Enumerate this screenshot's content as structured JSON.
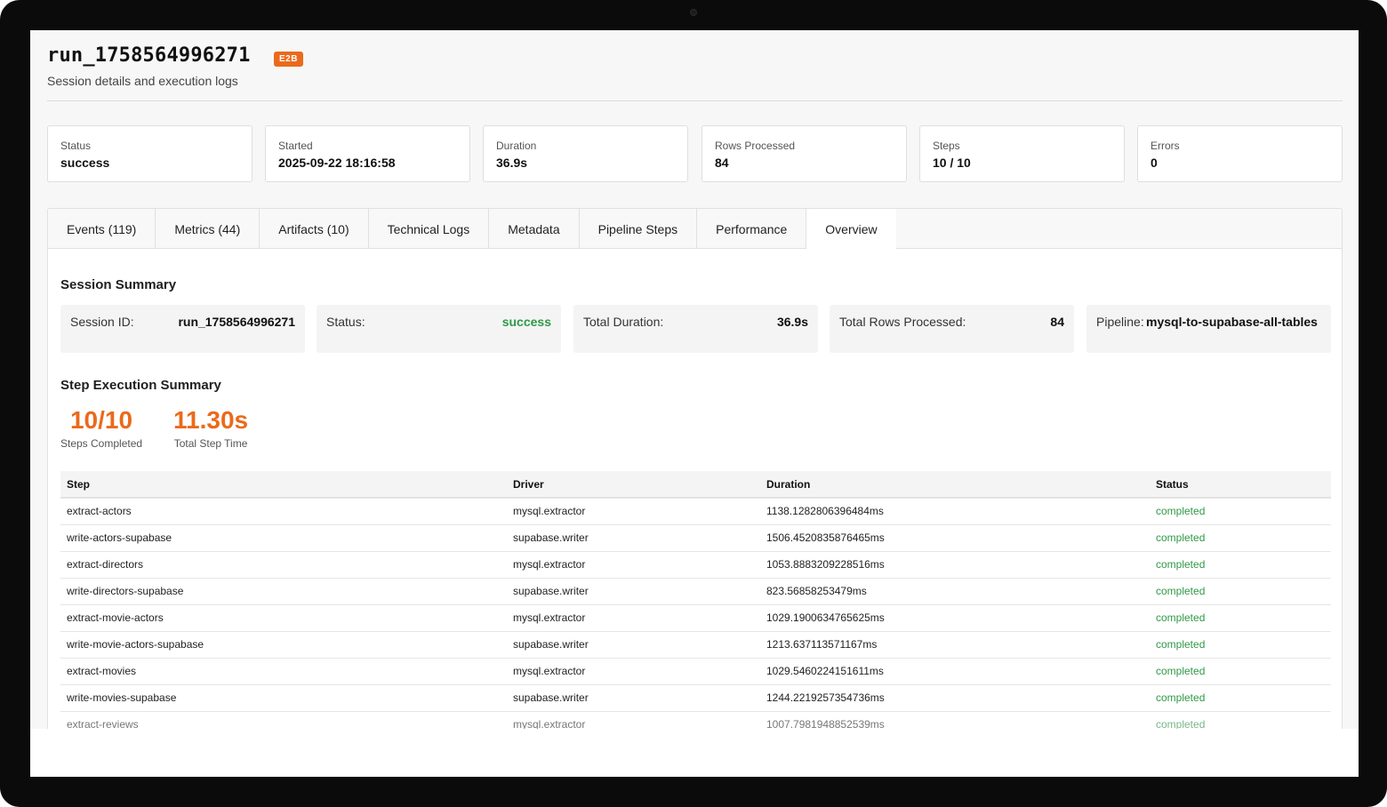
{
  "header": {
    "run_id": "run_1758564996271",
    "badge": "E2B",
    "subtitle": "Session details and execution logs"
  },
  "stats": [
    {
      "label": "Status",
      "value": "success"
    },
    {
      "label": "Started",
      "value": "2025-09-22 18:16:58"
    },
    {
      "label": "Duration",
      "value": "36.9s"
    },
    {
      "label": "Rows Processed",
      "value": "84"
    },
    {
      "label": "Steps",
      "value": "10 / 10"
    },
    {
      "label": "Errors",
      "value": "0"
    }
  ],
  "tabs": [
    {
      "label": "Events (119)"
    },
    {
      "label": "Metrics (44)"
    },
    {
      "label": "Artifacts (10)"
    },
    {
      "label": "Technical Logs"
    },
    {
      "label": "Metadata"
    },
    {
      "label": "Pipeline Steps"
    },
    {
      "label": "Performance"
    },
    {
      "label": "Overview",
      "active": true
    }
  ],
  "session_summary": {
    "title": "Session Summary",
    "session_id_label": "Session ID:",
    "session_id_value": "run_1758564996271",
    "status_label": "Status:",
    "status_value": "success",
    "duration_label": "Total Duration:",
    "duration_value": "36.9s",
    "rows_label": "Total Rows Processed:",
    "rows_value": "84",
    "pipeline_label": "Pipeline:",
    "pipeline_value": "mysql-to-supabase-all-tables"
  },
  "step_summary": {
    "title": "Step Execution Summary",
    "steps_completed_value": "10/10",
    "steps_completed_label": "Steps Completed",
    "total_step_time_value": "11.30s",
    "total_step_time_label": "Total Step Time"
  },
  "table": {
    "headers": [
      "Step",
      "Driver",
      "Duration",
      "Status"
    ],
    "rows": [
      [
        "extract-actors",
        "mysql.extractor",
        "1138.1282806396484ms",
        "completed"
      ],
      [
        "write-actors-supabase",
        "supabase.writer",
        "1506.4520835876465ms",
        "completed"
      ],
      [
        "extract-directors",
        "mysql.extractor",
        "1053.8883209228516ms",
        "completed"
      ],
      [
        "write-directors-supabase",
        "supabase.writer",
        "823.56858253479ms",
        "completed"
      ],
      [
        "extract-movie-actors",
        "mysql.extractor",
        "1029.1900634765625ms",
        "completed"
      ],
      [
        "write-movie-actors-supabase",
        "supabase.writer",
        "1213.637113571167ms",
        "completed"
      ],
      [
        "extract-movies",
        "mysql.extractor",
        "1029.5460224151611ms",
        "completed"
      ],
      [
        "write-movies-supabase",
        "supabase.writer",
        "1244.2219257354736ms",
        "completed"
      ],
      [
        "extract-reviews",
        "mysql.extractor",
        "1007.7981948852539ms",
        "completed"
      ]
    ]
  },
  "colors": {
    "accent": "#ea6a1c",
    "success": "#2e9a46"
  }
}
